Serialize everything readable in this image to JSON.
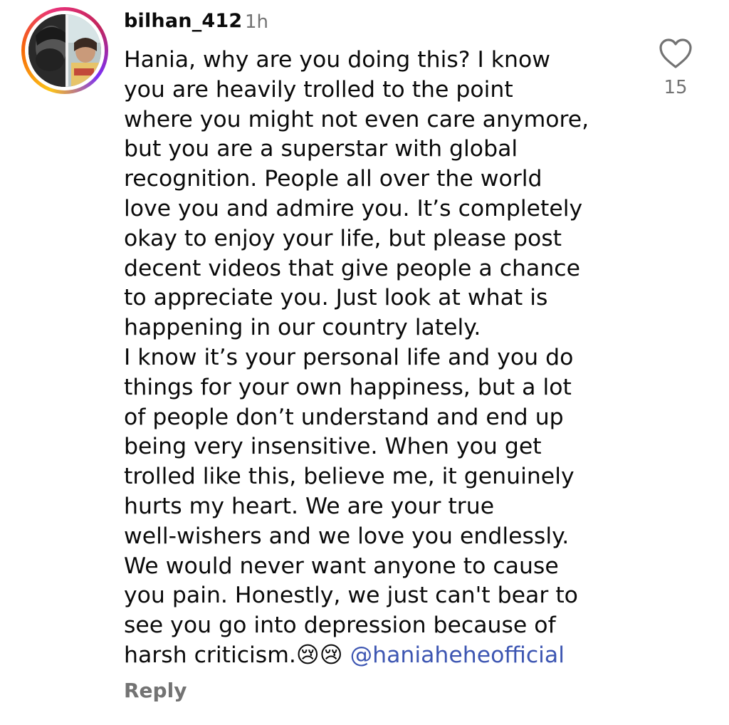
{
  "comment": {
    "username": "bilhan_412",
    "timestamp": "1h",
    "text_lines": [
      "Hania, why are you doing this? I know",
      "you are heavily trolled to the point",
      "where you might not even care anymore,",
      "but you are a superstar with global",
      "recognition. People all over the world",
      "love you and admire you. It’s completely",
      "okay to enjoy your life, but please post",
      "decent videos that give people a chance",
      "to appreciate you. Just look at what is",
      "happening in our country lately.",
      "I know it’s your personal life and you do",
      "things for your own happiness, but a lot",
      "of people don’t understand and end up",
      "being very insensitive. When you get",
      "trolled like this, believe me, it genuinely",
      "hurts my heart. We are your true",
      "well-wishers and we love you endlessly.",
      "We would never want anyone to cause",
      "you pain. Honestly, we just can't bear to",
      "see you go into depression because of"
    ],
    "last_line_text": "harsh criticism.",
    "emojis": "😢😢",
    "mention": "@haniaheheofficial",
    "reply_label": "Reply",
    "like_icon": "heart-outline-icon",
    "like_count": "15"
  },
  "colors": {
    "primary_text": "#0a0a0a",
    "secondary_text": "#737373",
    "mention": "#3d56b2",
    "story_ring": [
      "#fcc419",
      "#f76707",
      "#e8337a",
      "#7b2ff7"
    ]
  }
}
